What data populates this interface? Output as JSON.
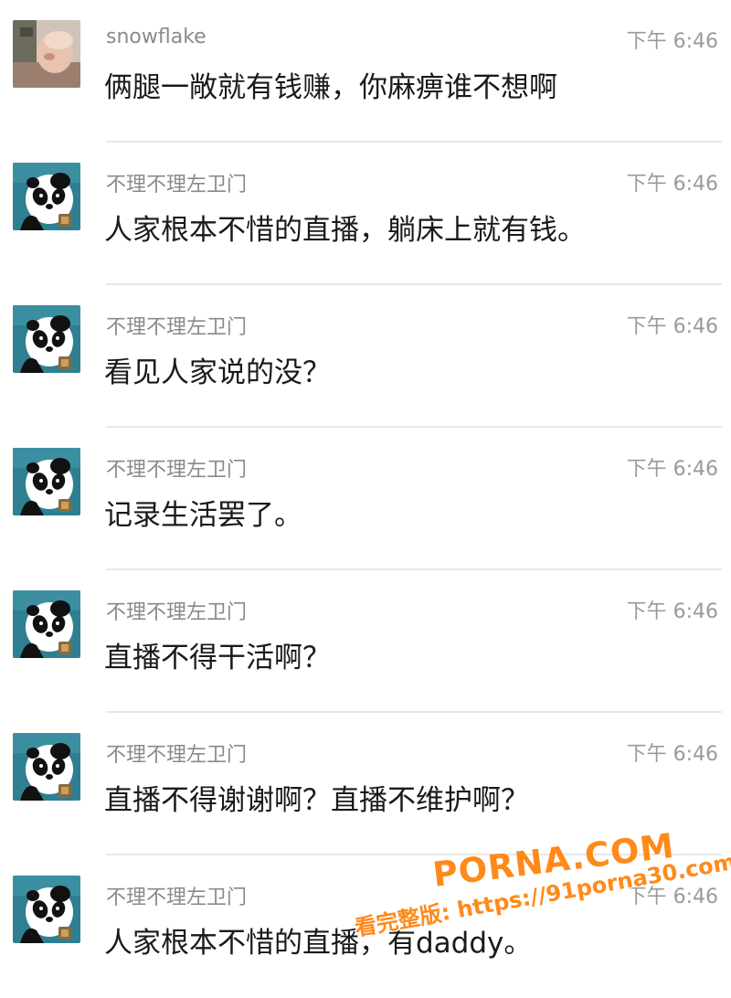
{
  "messages": [
    {
      "username": "snowflake",
      "time": "下午 6:46",
      "content": "俩腿一敞就有钱赚，你麻痹谁不想啊",
      "avatar": "photo-avatar"
    },
    {
      "username": "不理不理左卫门",
      "time": "下午 6:46",
      "content": "人家根本不惜的直播，躺床上就有钱。",
      "avatar": "panda-avatar"
    },
    {
      "username": "不理不理左卫门",
      "time": "下午 6:46",
      "content": "看见人家说的没？",
      "avatar": "panda-avatar"
    },
    {
      "username": "不理不理左卫门",
      "time": "下午 6:46",
      "content": "记录生活罢了。",
      "avatar": "panda-avatar"
    },
    {
      "username": "不理不理左卫门",
      "time": "下午 6:46",
      "content": "直播不得干活啊？",
      "avatar": "panda-avatar"
    },
    {
      "username": "不理不理左卫门",
      "time": "下午 6:46",
      "content": "直播不得谢谢啊？直播不维护啊？",
      "avatar": "panda-avatar"
    },
    {
      "username": "不理不理左卫门",
      "time": "下午 6:46",
      "content": "人家根本不惜的直播，有daddy。",
      "avatar": "panda-avatar"
    }
  ],
  "watermark": {
    "brand": "PORNA.COM",
    "url_text": "看完整版: https://91porna30.com"
  },
  "colors": {
    "username": "#8a8a8a",
    "time": "#9a9a9a",
    "content": "#1a1a1a",
    "divider": "#e7e7e7",
    "watermark": "#ff8a1a",
    "panda_bg": "#2f7f92"
  }
}
